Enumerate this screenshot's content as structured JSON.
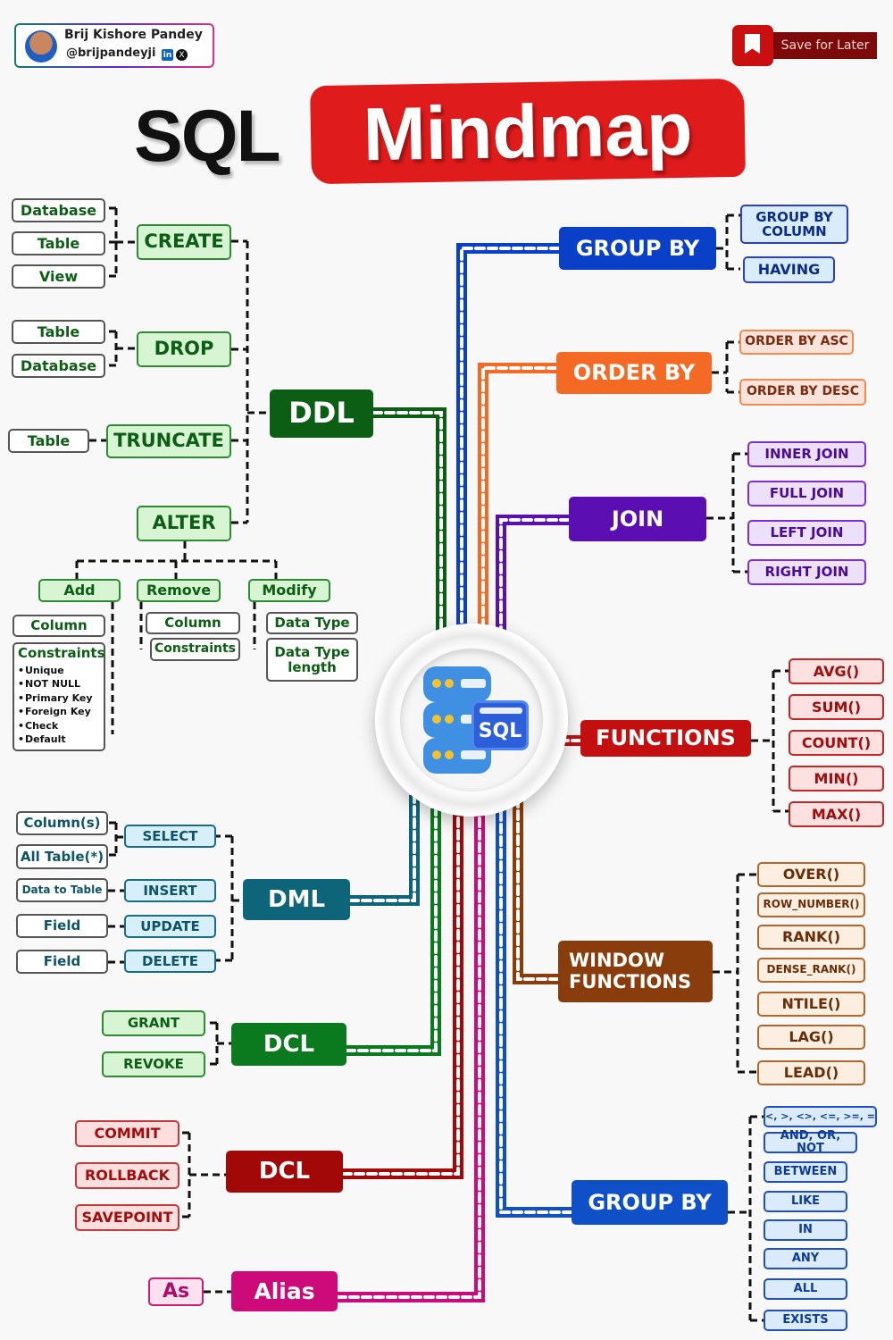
{
  "author": {
    "name": "Brij Kishore Pandey",
    "handle": "@brijpandeyji",
    "linkedin_icon": "in",
    "x_icon": "X"
  },
  "save_button": {
    "label": "Save for Later",
    "icon": "bookmark-icon"
  },
  "title": {
    "part1": "SQL",
    "part2": "Mindmap"
  },
  "hub": {
    "icon": "database-sql-icon",
    "label": "SQL"
  },
  "colors": {
    "ddl": "#0b5e14",
    "group_by": "#0a3fc7",
    "order_by": "#f46a24",
    "join": "#5b0fb3",
    "functions": "#c30f0f",
    "window": "#8a3d0c",
    "dml": "#0e6479",
    "dcl": "#0b7a1e",
    "tcl": "#a30808",
    "alias": "#cc0a7a",
    "where": "#0f4fc8"
  },
  "ddl": {
    "label": "DDL",
    "create": {
      "label": "CREATE",
      "items": [
        "Database",
        "Table",
        "View"
      ]
    },
    "drop": {
      "label": "DROP",
      "items": [
        "Table",
        "Database"
      ]
    },
    "truncate": {
      "label": "TRUNCATE",
      "items": [
        "Table"
      ]
    },
    "alter": {
      "label": "ALTER",
      "add": {
        "label": "Add",
        "column": "Column",
        "constraints_title": "Constraints",
        "constraints": [
          "Unique",
          "NOT NULL",
          "Primary Key",
          "Foreign Key",
          "Check",
          "Default"
        ]
      },
      "remove": {
        "label": "Remove",
        "items": [
          "Column",
          "Constraints"
        ]
      },
      "modify": {
        "label": "Modify",
        "items": [
          "Data Type",
          "Data Type length"
        ]
      }
    }
  },
  "group_by": {
    "label": "GROUP BY",
    "items": [
      "GROUP BY COLUMN",
      "HAVING"
    ]
  },
  "order_by": {
    "label": "ORDER BY",
    "items": [
      "ORDER BY ASC",
      "ORDER BY DESC"
    ]
  },
  "join": {
    "label": "JOIN",
    "items": [
      "INNER JOIN",
      "FULL JOIN",
      "LEFT JOIN",
      "RIGHT JOIN"
    ]
  },
  "functions": {
    "label": "FUNCTIONS",
    "items": [
      "AVG()",
      "SUM()",
      "COUNT()",
      "MIN()",
      "MAX()"
    ]
  },
  "window_functions": {
    "label_line1": "WINDOW",
    "label_line2": "FUNCTIONS",
    "items": [
      "OVER()",
      "ROW_NUMBER()",
      "RANK()",
      "DENSE_RANK()",
      "NTILE()",
      "LAG()",
      "LEAD()"
    ]
  },
  "dml": {
    "label": "DML",
    "commands": [
      {
        "label": "SELECT",
        "targets": [
          "Column(s)",
          "All Table(*)"
        ]
      },
      {
        "label": "INSERT",
        "targets": [
          "Data to Table"
        ]
      },
      {
        "label": "UPDATE",
        "targets": [
          "Field"
        ]
      },
      {
        "label": "DELETE",
        "targets": [
          "Field"
        ]
      }
    ]
  },
  "dcl": {
    "label": "DCL",
    "items": [
      "GRANT",
      "REVOKE"
    ]
  },
  "tcl": {
    "label": "DCL",
    "items": [
      "COMMIT",
      "ROLLBACK",
      "SAVEPOINT"
    ]
  },
  "alias": {
    "label": "Alias",
    "items": [
      "As"
    ]
  },
  "where": {
    "label": "GROUP BY",
    "items": [
      "<, >, <>, <=, >=, =",
      "AND, OR, NOT",
      "BETWEEN",
      "LIKE",
      "IN",
      "ANY",
      "ALL",
      "EXISTS"
    ]
  }
}
